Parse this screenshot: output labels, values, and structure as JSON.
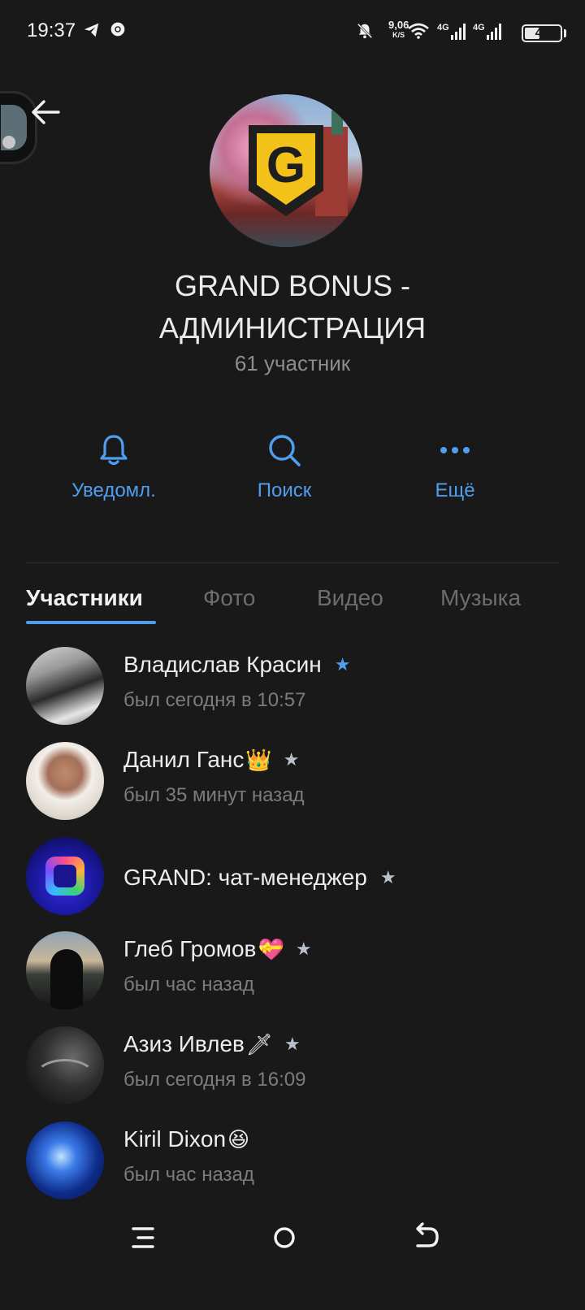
{
  "status_bar": {
    "time": "19:37",
    "speed_value": "9,06",
    "speed_unit": "K/S",
    "signal1_label": "4G",
    "signal2_label": "4G",
    "battery": "42",
    "battery_level": 0.42,
    "icons": [
      "telegram-icon",
      "chrome-icon",
      "mute-bell-icon",
      "wifi-icon",
      "signal-icon",
      "battery-icon"
    ]
  },
  "header": {
    "back_icon": "arrow-left-icon",
    "title_line1": "GRAND BONUS -",
    "title_line2": "АДМИНИСТРАЦИЯ",
    "members": "61 участник",
    "logo_letter": "G"
  },
  "actions": [
    {
      "label": "Уведомл.",
      "icon": "bell-icon"
    },
    {
      "label": "Поиск",
      "icon": "search-icon"
    },
    {
      "label": "Ещё",
      "icon": "more-dots-icon"
    }
  ],
  "tabs": [
    {
      "label": "Участники",
      "active": true
    },
    {
      "label": "Фото",
      "active": false
    },
    {
      "label": "Видео",
      "active": false
    },
    {
      "label": "Музыка",
      "active": false
    }
  ],
  "members_list": [
    {
      "name": "Владислав Красин",
      "emoji": "",
      "star": "★",
      "status": "был сегодня в 10:57"
    },
    {
      "name": "Данил Ганс",
      "emoji": "👑",
      "star": "★",
      "status": "был 35 минут назад"
    },
    {
      "name": "GRAND: чат-менеджер",
      "emoji": "",
      "star": "★",
      "status": ""
    },
    {
      "name": "Глеб Громов",
      "emoji": "💝",
      "star": "★",
      "status": "был час назад"
    },
    {
      "name": "Азиз Ивлев",
      "emoji": "🗡",
      "star": "★",
      "status": "был сегодня в 16:09"
    },
    {
      "name": "Kiril Dixon",
      "emoji": "😆",
      "star": "",
      "status": "был час назад"
    }
  ],
  "colors": {
    "background": "#191919",
    "accent": "#4f9ef0",
    "text_secondary": "#7c7c7c"
  }
}
